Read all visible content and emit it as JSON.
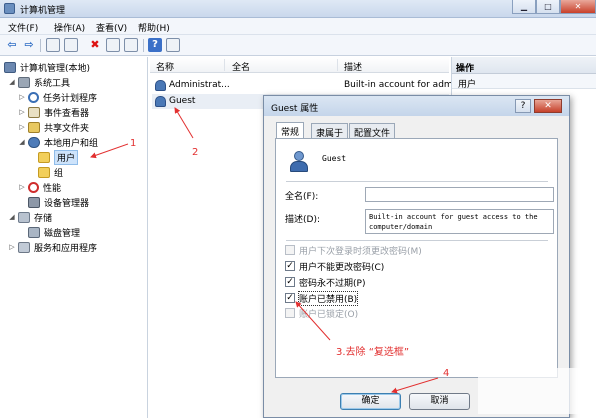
{
  "window": {
    "title": "计算机管理"
  },
  "menu": [
    "文件(F)",
    "操作(A)",
    "查看(V)",
    "帮助(H)"
  ],
  "tree": {
    "items": [
      {
        "label": "计算机管理(本地)"
      },
      {
        "label": "系统工具"
      },
      {
        "label": "任务计划程序"
      },
      {
        "label": "事件查看器"
      },
      {
        "label": "共享文件夹"
      },
      {
        "label": "本地用户和组"
      },
      {
        "label": "用户"
      },
      {
        "label": "组"
      },
      {
        "label": "性能"
      },
      {
        "label": "设备管理器"
      },
      {
        "label": "存储"
      },
      {
        "label": "磁盘管理"
      },
      {
        "label": "服务和应用程序"
      }
    ]
  },
  "list": {
    "columns": [
      "名称",
      "全名",
      "描述"
    ],
    "rows": [
      {
        "name": "Administrat...",
        "description": "Built-in account for adm"
      },
      {
        "name": "Guest",
        "description": ""
      }
    ]
  },
  "actions": {
    "header": "操作",
    "sub": "用户"
  },
  "dialog": {
    "title": "Guest 属性",
    "help_glyph": "?",
    "close_glyph": "✕",
    "tabs": [
      "常规",
      "隶属于",
      "配置文件"
    ],
    "account_name": "Guest",
    "fullname_label": "全名(F):",
    "fullname_value": "",
    "description_label": "描述(D):",
    "description_value": "Built-in account for guest access to the computer/domain",
    "checkboxes": [
      {
        "label": "用户下次登录时须更改密码(M)",
        "checked": false,
        "enabled": false
      },
      {
        "label": "用户不能更改密码(C)",
        "checked": true,
        "enabled": true
      },
      {
        "label": "密码永不过期(P)",
        "checked": true,
        "enabled": true
      },
      {
        "label": "账户已禁用(B)",
        "checked": true,
        "enabled": true
      },
      {
        "label": "账户已锁定(O)",
        "checked": false,
        "enabled": false
      }
    ],
    "ok_label": "确定",
    "cancel_label": "取消"
  },
  "annotations": {
    "n1": "1",
    "n2": "2",
    "n3": "3.去除 “复选框”",
    "n4": "4",
    "color": "#e23030"
  }
}
